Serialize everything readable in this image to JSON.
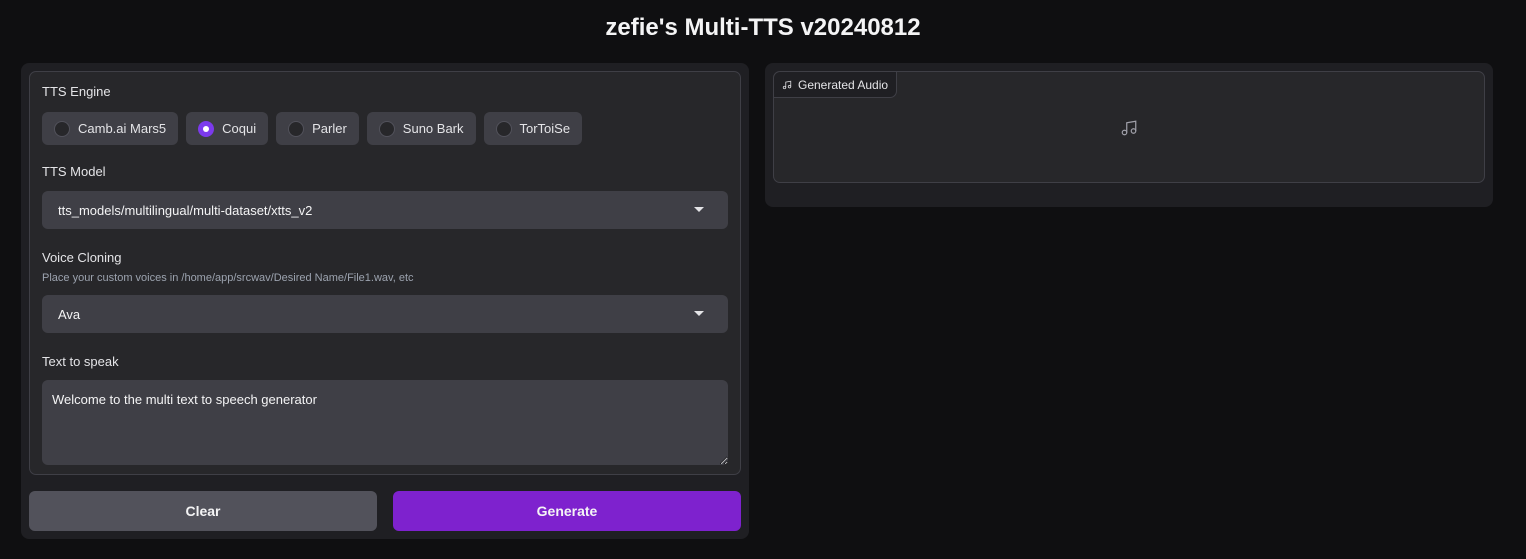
{
  "app": {
    "title": "zefie's Multi-TTS v20240812"
  },
  "tts_engine": {
    "label": "TTS Engine",
    "options": [
      "Camb.ai Mars5",
      "Coqui",
      "Parler",
      "Suno Bark",
      "TorToiSe"
    ],
    "selected": "Coqui"
  },
  "tts_model": {
    "label": "TTS Model",
    "value": "tts_models/multilingual/multi-dataset/xtts_v2"
  },
  "voice_cloning": {
    "label": "Voice Cloning",
    "info": "Place your custom voices in /home/app/srcwav/Desired Name/File1.wav, etc",
    "value": "Ava"
  },
  "text_to_speak": {
    "label": "Text to speak",
    "value": "Welcome to the multi text to speech generator"
  },
  "buttons": {
    "clear": "Clear",
    "generate": "Generate"
  },
  "audio": {
    "label": "Generated Audio",
    "icon": "music-note-icon"
  },
  "colors": {
    "accent": "#7e22ce",
    "background": "#0f0f11"
  }
}
